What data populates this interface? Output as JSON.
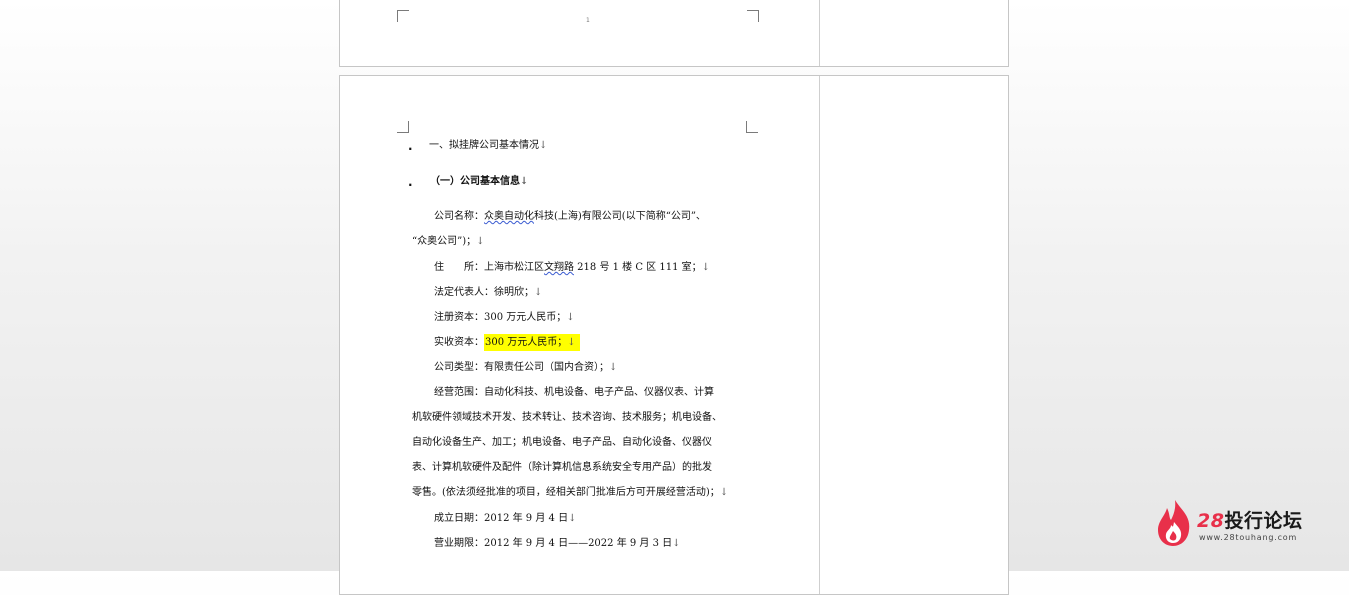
{
  "previous_page": {
    "page_number_mark": "1"
  },
  "document": {
    "heading_1": "一、拟挂牌公司基本情况",
    "heading_2": "（一）公司基本信息",
    "company_name_label": "公司名称：",
    "company_name_part1": "众奥自动化",
    "company_name_part2": "科技(上海)有限公司(以下简称“公司”、",
    "company_name_cont": "“众奥公司”)；",
    "address_label": "住　　所：",
    "address_part1": "上海市松江区",
    "address_part2": "文翔路",
    "address_part3": " 218 号 1 楼 C 区 111 室；",
    "legal_rep": "法定代表人：徐明欣；",
    "registered_capital": "注册资本：300 万元人民币；",
    "paid_capital_label": "实收资本：",
    "paid_capital_value": "300 万元人民币；",
    "company_type": "公司类型：有限责任公司（国内合资）；",
    "scope_line1": "经营范围：自动化科技、机电设备、电子产品、仪器仪表、计算",
    "scope_line2": "机软硬件领域技术开发、技术转让、技术咨询、技术服务；机电设备、",
    "scope_line3": "自动化设备生产、加工；机电设备、电子产品、自动化设备、仪器仪",
    "scope_line4": "表、计算机软硬件及配件（除计算机信息系统安全专用产品）的批发",
    "scope_line5": "零售。(依法须经批准的项目，经相关部门批准后方可开展经营活动)；",
    "established_date": "成立日期：2012 年 9 月 4 日",
    "business_term": "营业期限：2012 年 9 月 4 日——2022 年 9 月 3 日",
    "paragraph_mark": "↓"
  },
  "watermark": {
    "brand_number": "28",
    "brand_name": "投行论坛",
    "url": "www.28touhang.com"
  },
  "colors": {
    "highlight": "#ffff00",
    "brand_red": "#e8304a"
  }
}
